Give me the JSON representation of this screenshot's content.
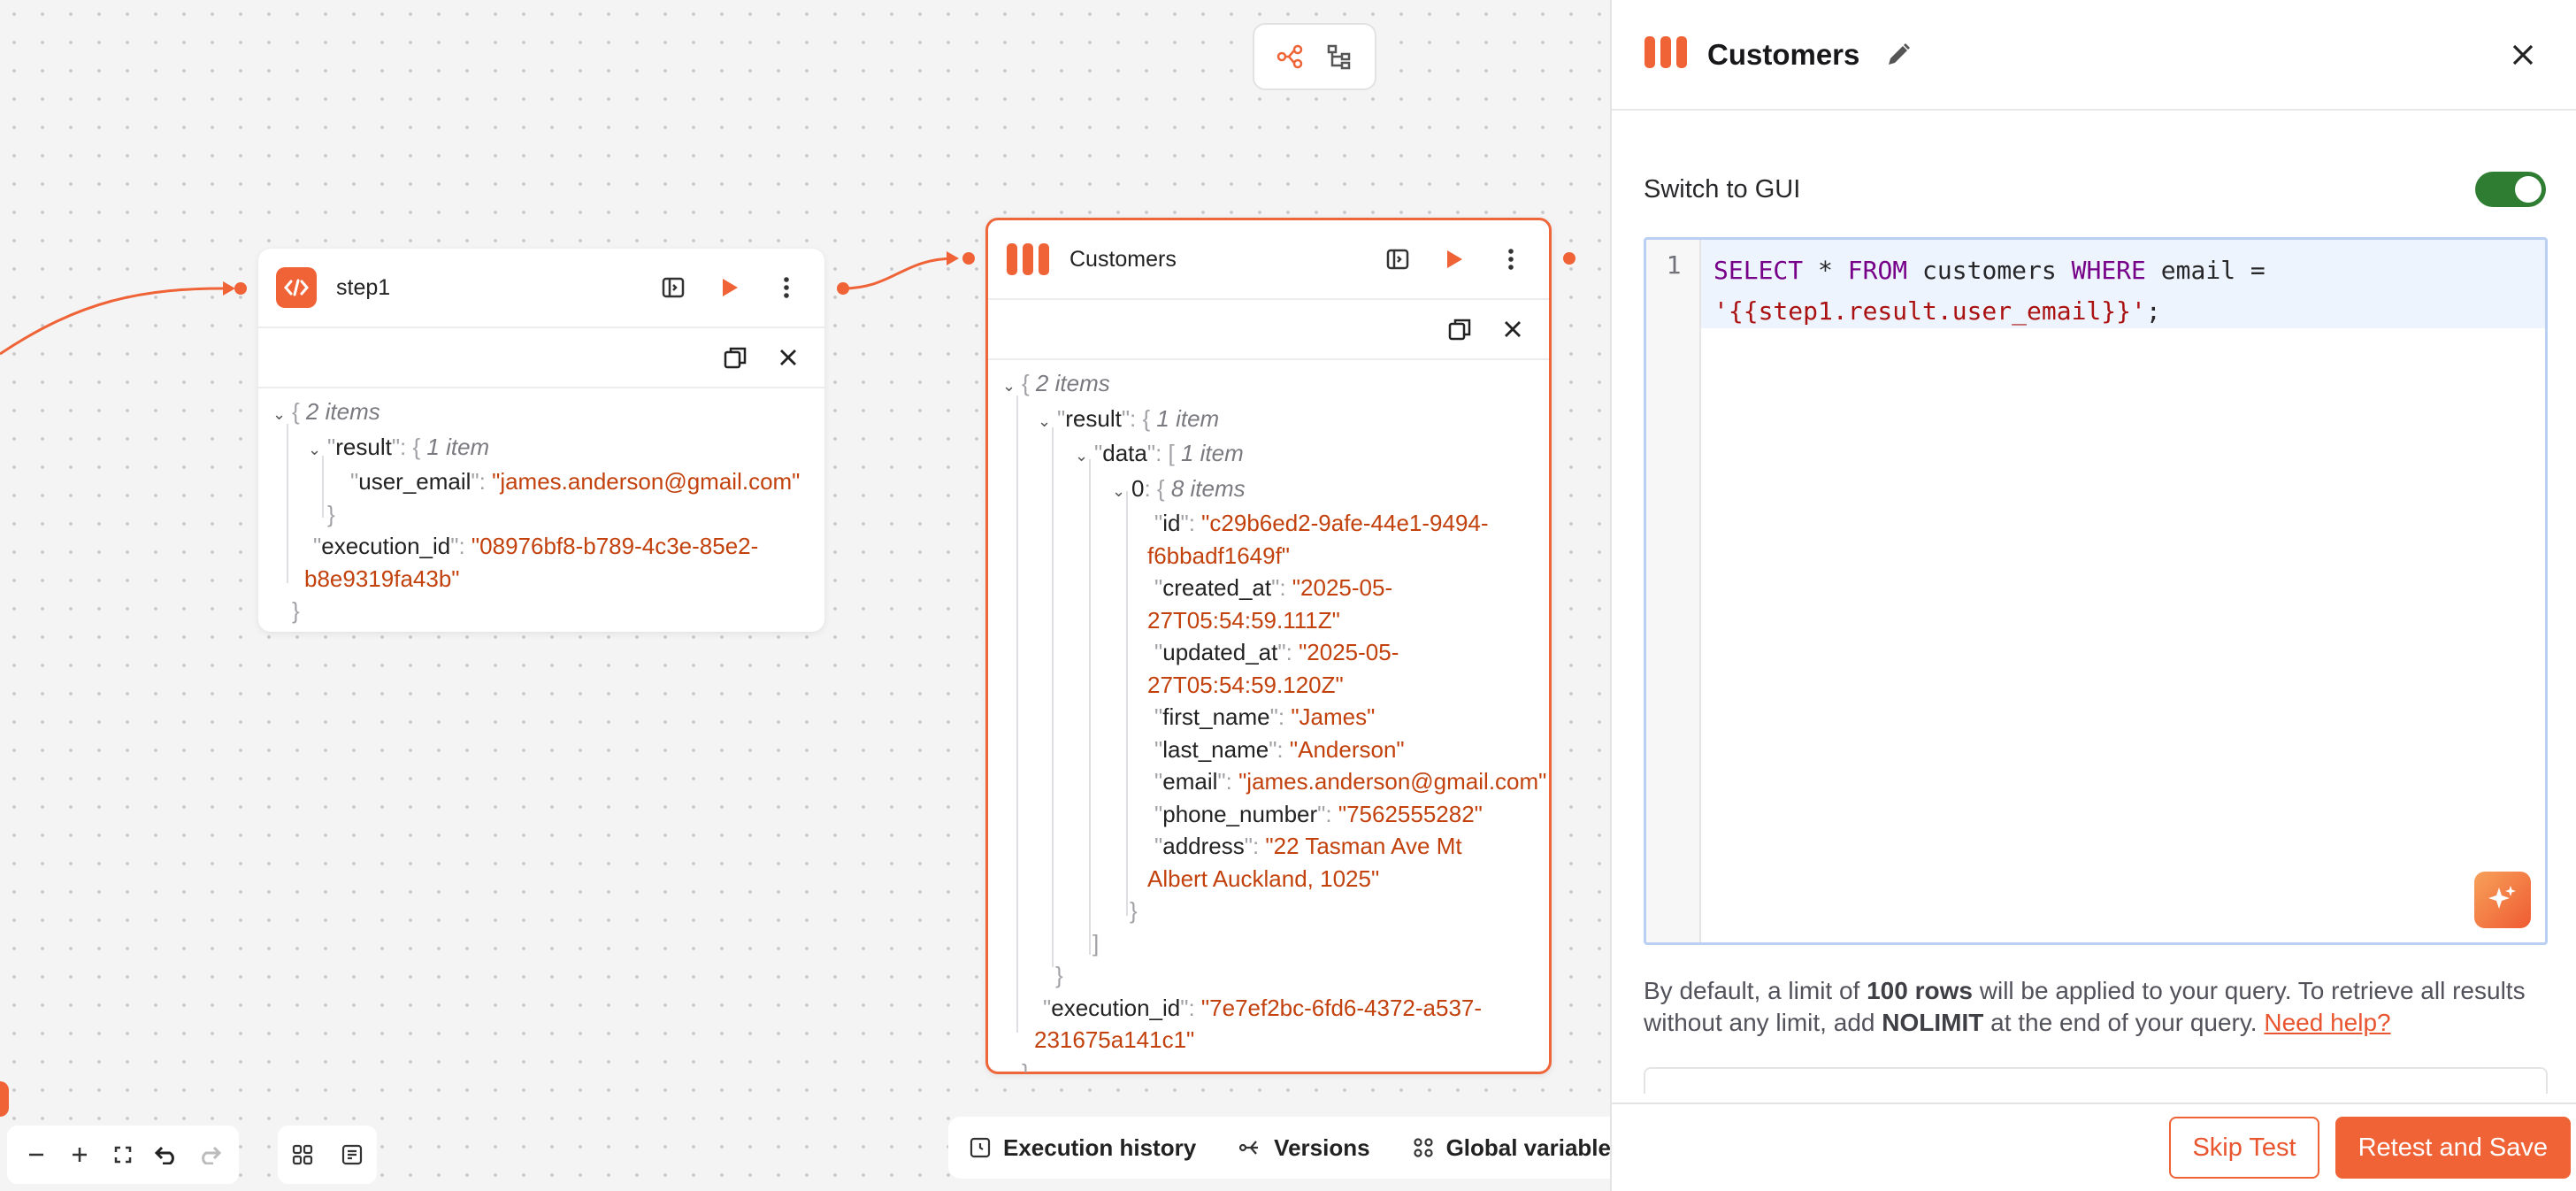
{
  "step1_node": {
    "title": "step1",
    "json": {
      "root_count": "2 items",
      "result_key": "result",
      "result_count": "1 item",
      "user_email_key": "user_email",
      "user_email_val": "\"james.anderson@gmail.com\"",
      "execution_id_key": "execution_id",
      "execution_id_val_1": "\"08976bf8-b789-4c3e-85e2-",
      "execution_id_val_2": "b8e9319fa43b\""
    }
  },
  "customers_node": {
    "title": "Customers",
    "json": {
      "root_count": "2 items",
      "result_key": "result",
      "result_count": "1 item",
      "data_key": "data",
      "data_count": "1 item",
      "index_key": "0",
      "index_count": "8 items",
      "id_key": "id",
      "id_val_1": "\"c29b6ed2-9afe-44e1-9494-",
      "id_val_2": "f6bbadf1649f\"",
      "created_at_key": "created_at",
      "created_at_val_1": "\"2025-05-",
      "created_at_val_2": "27T05:54:59.111Z\"",
      "updated_at_key": "updated_at",
      "updated_at_val_1": "\"2025-05-",
      "updated_at_val_2": "27T05:54:59.120Z\"",
      "first_name_key": "first_name",
      "first_name_val": "\"James\"",
      "last_name_key": "last_name",
      "last_name_val": "\"Anderson\"",
      "email_key": "email",
      "email_val": "\"james.anderson@gmail.com\"",
      "phone_key": "phone_number",
      "phone_val": "\"7562555282\"",
      "address_key": "address",
      "address_val_1": "\"22 Tasman Ave Mt",
      "address_val_2": "Albert Auckland, 1025\"",
      "execution_id_key": "execution_id",
      "execution_id_val_1": "\"7e7ef2bc-6fd6-4372-a537-",
      "execution_id_val_2": "231675a141c1\""
    }
  },
  "bottom_bar": {
    "execution_history": "Execution history",
    "versions": "Versions",
    "global_variables": "Global variables"
  },
  "panel": {
    "title": "Customers",
    "switch_label": "Switch to GUI",
    "switch_on": true,
    "line_number": "1",
    "query_line1_kw1": "SELECT",
    "query_line1_a": " * ",
    "query_line1_kw2": "FROM",
    "query_line1_b": " customers ",
    "query_line1_kw3": "WHERE",
    "query_line1_c": " email =",
    "query_line2": "'{{step1.result.user_email}}'",
    "query_line2_end": ";",
    "note_1": "By default, a limit of ",
    "note_bold1": "100 rows",
    "note_2": " will be applied to your query. To retrieve all results without any limit, add ",
    "note_bold2": "NOLIMIT",
    "note_3": " at the end of your query. ",
    "note_link": "Need help?",
    "skip_test": "Skip Test",
    "retest_save": "Retest and Save"
  },
  "colors": {
    "accent": "#ef6337",
    "string_value": "#c2410c",
    "toggle_on": "#2e7d32"
  }
}
